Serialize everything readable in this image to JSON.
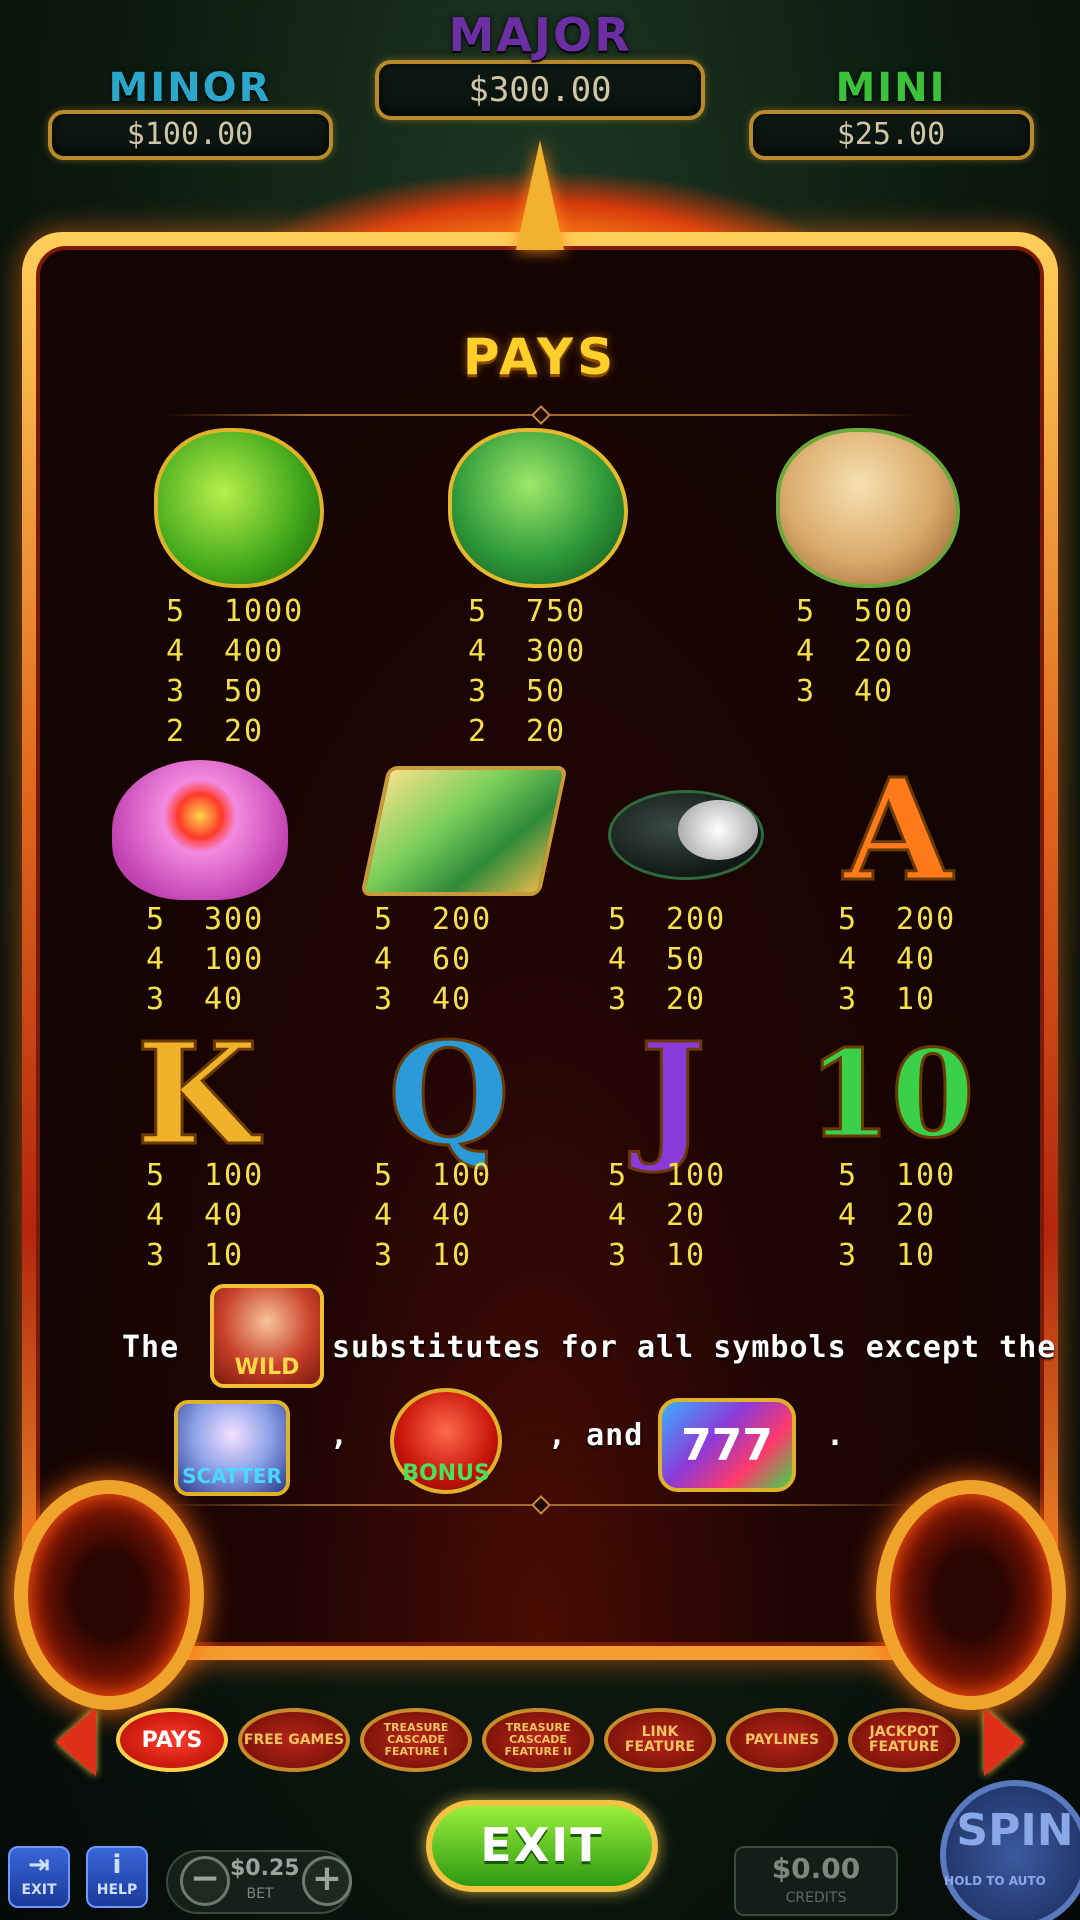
{
  "jackpots": {
    "minor": {
      "label": "MINOR",
      "value": "$100.00"
    },
    "major": {
      "label": "MAJOR",
      "value": "$300.00"
    },
    "mini": {
      "label": "MINI",
      "value": "$25.00"
    }
  },
  "panel": {
    "title": "PAYS",
    "symbols": [
      {
        "name": "green-frog-dragon",
        "pays": [
          [
            "5",
            "1000"
          ],
          [
            "4",
            "400"
          ],
          [
            "3",
            "50"
          ],
          [
            "2",
            "20"
          ]
        ]
      },
      {
        "name": "jade-goblin",
        "pays": [
          [
            "5",
            "750"
          ],
          [
            "4",
            "300"
          ],
          [
            "3",
            "50"
          ],
          [
            "2",
            "20"
          ]
        ]
      },
      {
        "name": "lotus-root-doll",
        "pays": [
          [
            "5",
            "500"
          ],
          [
            "4",
            "200"
          ],
          [
            "3",
            "40"
          ]
        ]
      },
      {
        "name": "lotus-flower",
        "pays": [
          [
            "5",
            "300"
          ],
          [
            "4",
            "100"
          ],
          [
            "3",
            "40"
          ]
        ]
      },
      {
        "name": "mountain-scroll",
        "pays": [
          [
            "5",
            "200"
          ],
          [
            "4",
            "60"
          ],
          [
            "3",
            "40"
          ]
        ]
      },
      {
        "name": "ink-brush-stone",
        "pays": [
          [
            "5",
            "200"
          ],
          [
            "4",
            "50"
          ],
          [
            "3",
            "20"
          ]
        ]
      },
      {
        "name": "letter-a",
        "glyph": "A",
        "pays": [
          [
            "5",
            "200"
          ],
          [
            "4",
            "40"
          ],
          [
            "3",
            "10"
          ]
        ]
      },
      {
        "name": "letter-k",
        "glyph": "K",
        "pays": [
          [
            "5",
            "100"
          ],
          [
            "4",
            "40"
          ],
          [
            "3",
            "10"
          ]
        ]
      },
      {
        "name": "letter-q",
        "glyph": "Q",
        "pays": [
          [
            "5",
            "100"
          ],
          [
            "4",
            "40"
          ],
          [
            "3",
            "10"
          ]
        ]
      },
      {
        "name": "letter-j",
        "glyph": "J",
        "pays": [
          [
            "5",
            "100"
          ],
          [
            "4",
            "20"
          ],
          [
            "3",
            "10"
          ]
        ]
      },
      {
        "name": "number-10",
        "glyph": "10",
        "pays": [
          [
            "5",
            "100"
          ],
          [
            "4",
            "20"
          ],
          [
            "3",
            "10"
          ]
        ]
      }
    ],
    "rule": {
      "the": "The",
      "wild_label": "WILD",
      "substitutes": "substitutes for all symbols except the",
      "scatter_label": "SCATTER",
      "comma": ",",
      "bonus_label": "BONUS",
      "and": ", and",
      "seven_label": "777",
      "period": "."
    }
  },
  "tabs": [
    {
      "label": "PAYS",
      "active": true
    },
    {
      "label": "FREE GAMES",
      "active": false
    },
    {
      "label": "TREASURE CASCADE FEATURE I",
      "active": false
    },
    {
      "label": "TREASURE CASCADE FEATURE II",
      "active": false
    },
    {
      "label": "LINK FEATURE",
      "active": false
    },
    {
      "label": "PAYLINES",
      "active": false
    },
    {
      "label": "JACKPOT FEATURE",
      "active": false
    }
  ],
  "bottom": {
    "exit_label": "EXIT",
    "exit_small": "EXIT",
    "help_small": "HELP",
    "bet_value": "$0.25",
    "bet_label": "BET",
    "credits_value": "$0.00",
    "credits_label": "CREDITS",
    "spin_label": "SPIN",
    "spin_hint": "HOLD TO AUTO"
  },
  "colors": {
    "pay_text": "#f4e04a",
    "title": "#ffd02a",
    "frame": "#e0651c"
  }
}
